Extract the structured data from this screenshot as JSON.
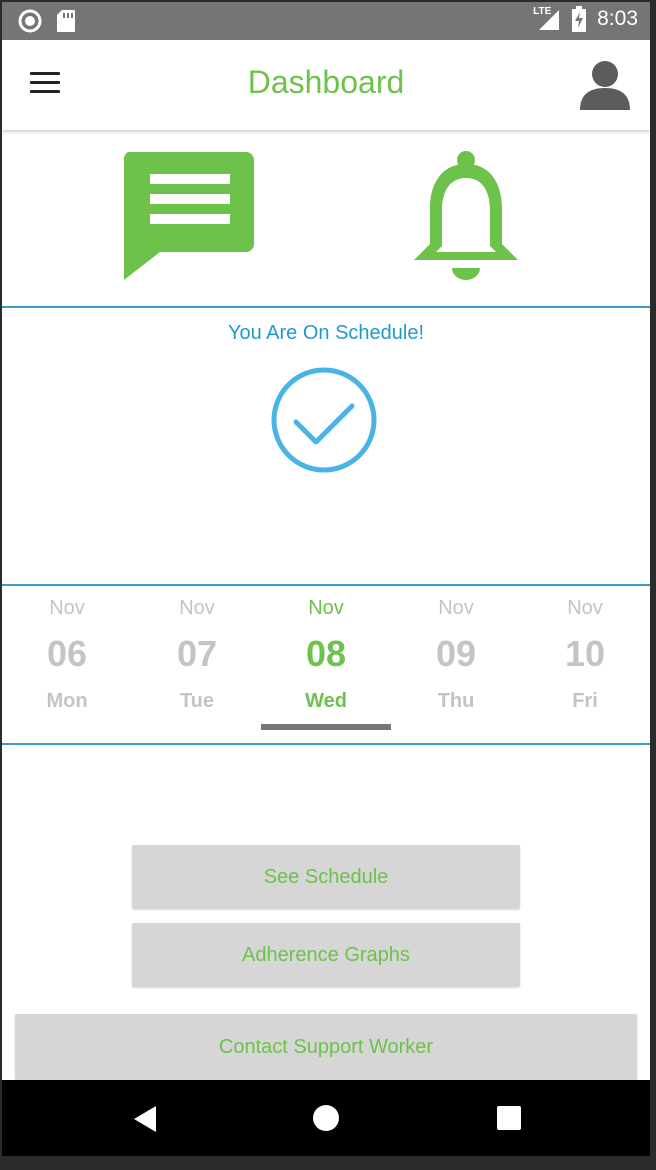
{
  "status_bar": {
    "time": "8:03",
    "network": "LTE",
    "icons": [
      "record-icon",
      "sd-card-icon",
      "signal-icon",
      "battery-charging-icon"
    ]
  },
  "app_bar": {
    "title": "Dashboard",
    "menu_icon": "hamburger-menu-icon",
    "profile_icon": "user-avatar-icon"
  },
  "quick_actions": {
    "messages_icon": "chat-bubble-icon",
    "notifications_icon": "bell-icon"
  },
  "status": {
    "message": "You Are On Schedule!",
    "icon": "check-circle-icon"
  },
  "dates": [
    {
      "month": "Nov",
      "day": "06",
      "weekday": "Mon",
      "selected": false
    },
    {
      "month": "Nov",
      "day": "07",
      "weekday": "Tue",
      "selected": false
    },
    {
      "month": "Nov",
      "day": "08",
      "weekday": "Wed",
      "selected": true
    },
    {
      "month": "Nov",
      "day": "09",
      "weekday": "Thu",
      "selected": false
    },
    {
      "month": "Nov",
      "day": "10",
      "weekday": "Fri",
      "selected": false
    }
  ],
  "buttons": {
    "see_schedule": "See Schedule",
    "adherence_graphs": "Adherence Graphs",
    "contact_support": "Contact Support Worker"
  },
  "colors": {
    "accent_green": "#6cc24a",
    "status_blue": "#1f9ad1",
    "divider_blue": "#3a9ad1",
    "inactive_gray": "#c4c4c4",
    "button_gray": "#d6d6d6"
  }
}
